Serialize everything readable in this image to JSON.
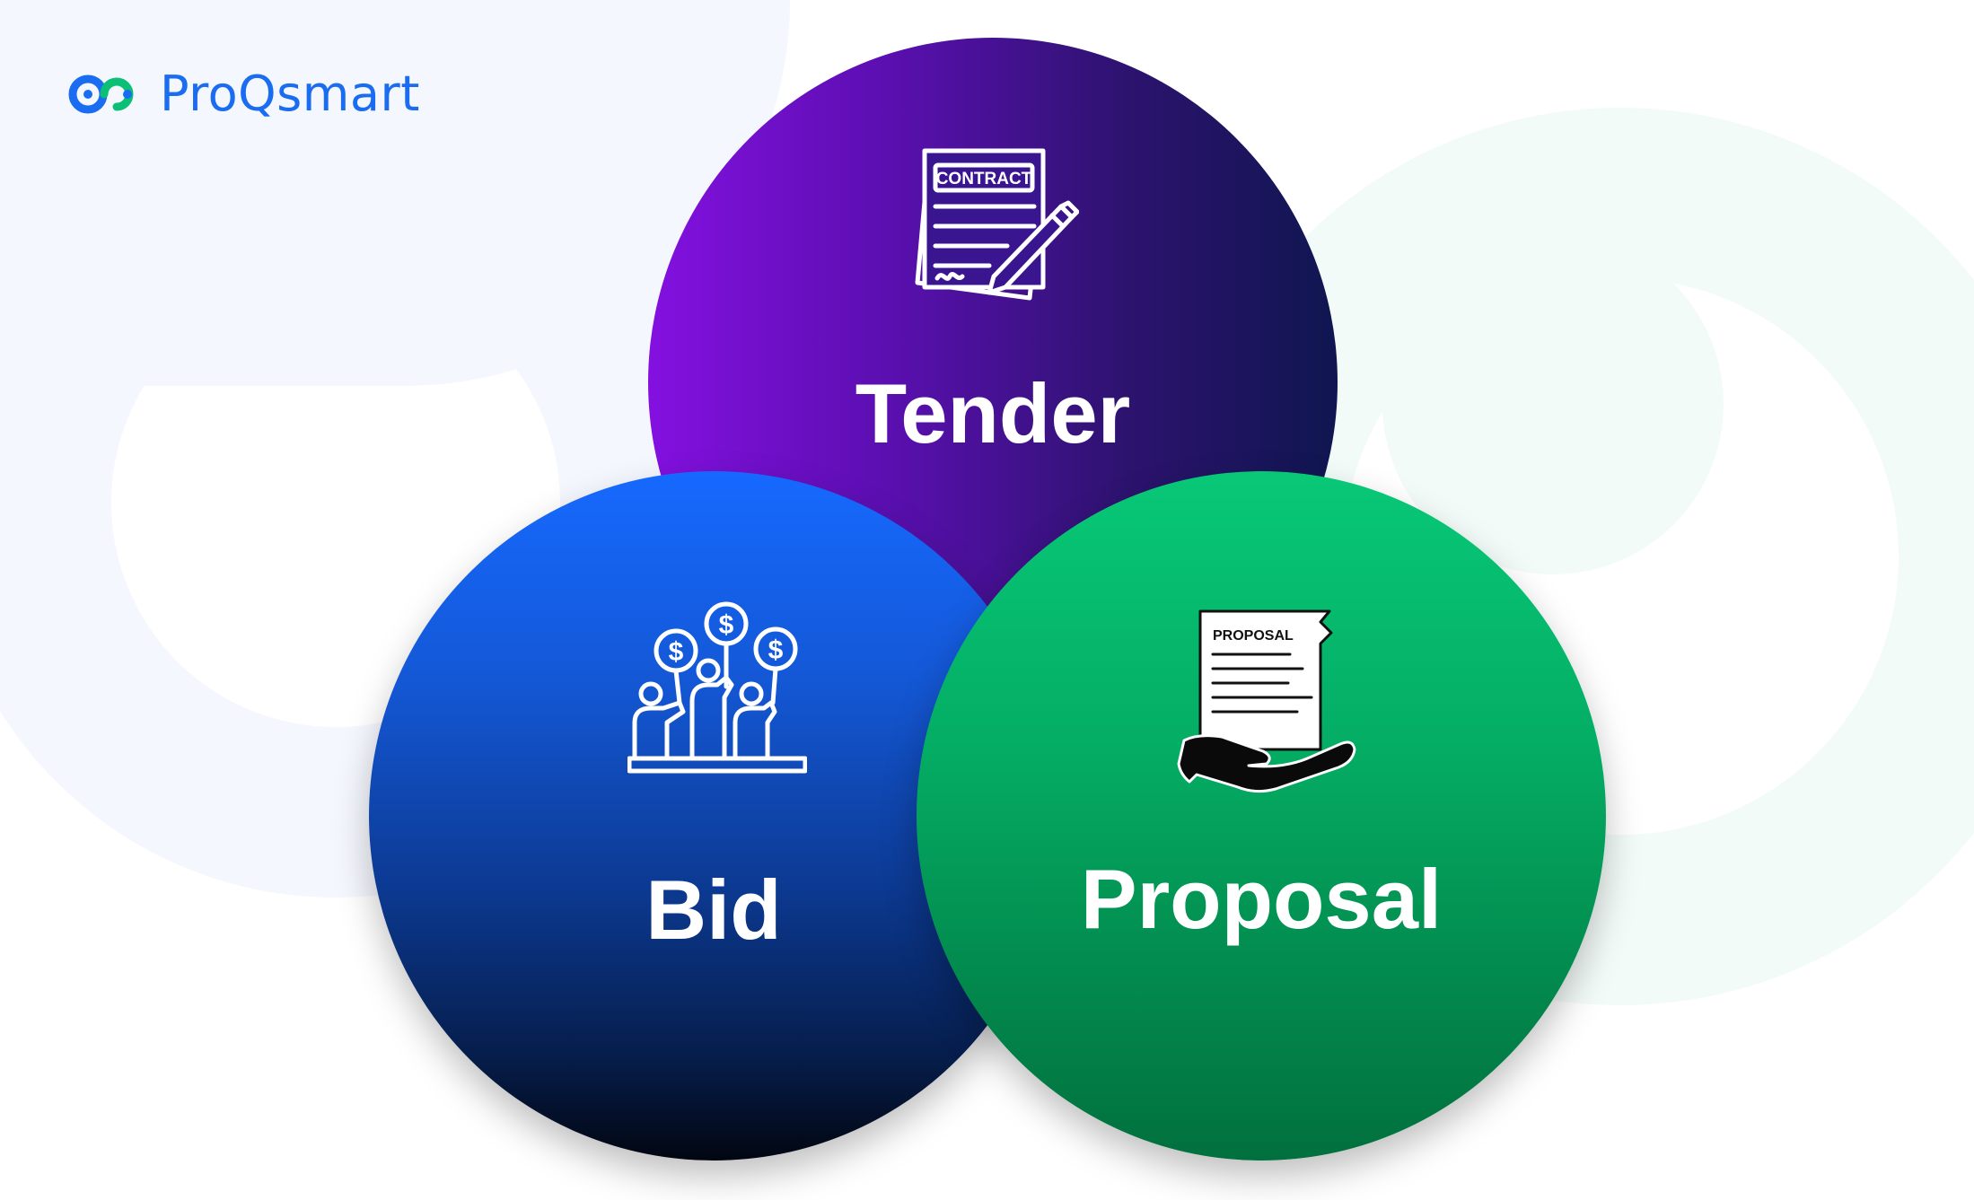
{
  "brand": {
    "name": "ProQsmart",
    "color": "#1a6cf0",
    "logo_icon": "infinity-link-icon"
  },
  "circles": {
    "tender": {
      "label": "Tender",
      "icon": "contract-icon",
      "icon_text": "CONTRACT",
      "color_from": "#8410e0",
      "color_to": "#0f1650"
    },
    "bid": {
      "label": "Bid",
      "icon": "bidders-icon",
      "color_from": "#1669ff",
      "color_to": "#020611"
    },
    "proposal": {
      "label": "Proposal",
      "icon": "proposal-icon",
      "icon_text": "PROPOSAL",
      "color_from": "#08c877",
      "color_to": "#01703e"
    }
  },
  "colors": {
    "background": "#ffffff",
    "deco_left": "#f4f7fd",
    "deco_right": "#f3fbf8"
  }
}
